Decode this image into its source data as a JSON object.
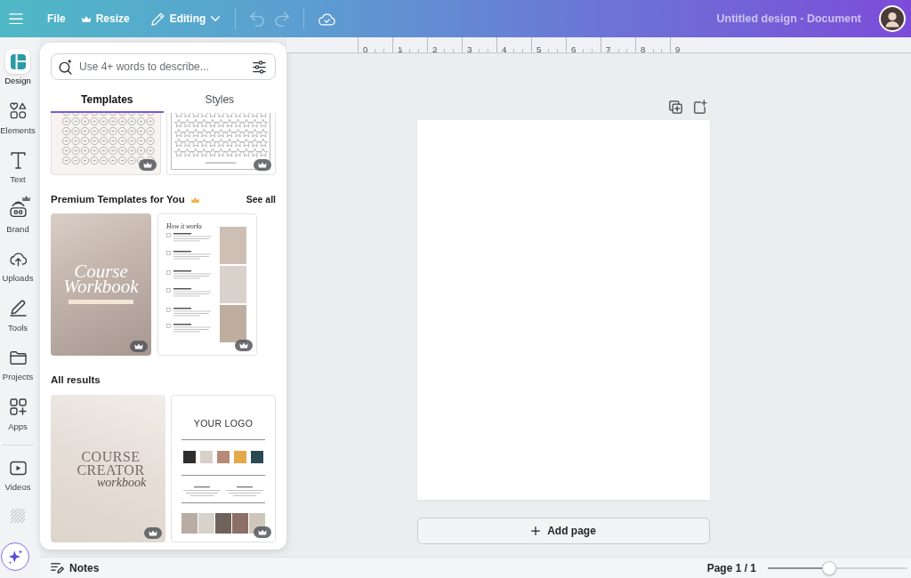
{
  "top_bar": {
    "buttons": [
      {
        "label": "File",
        "kind": "plain"
      },
      {
        "label": "Resize",
        "kind": "premium"
      },
      {
        "label": "Editing",
        "kind": "dropdown"
      }
    ],
    "history": [
      {
        "kind": "undo",
        "disabled": true
      },
      {
        "kind": "redo",
        "disabled": true
      }
    ],
    "title": "Untitled design - Document"
  },
  "sidebar": {
    "items": [
      {
        "label": "Design",
        "selected": true,
        "premium": false
      },
      {
        "label": "Elements",
        "selected": false,
        "premium": false
      },
      {
        "label": "Text",
        "selected": false,
        "premium": false
      },
      {
        "label": "Brand",
        "selected": false,
        "premium": true
      },
      {
        "label": "Uploads",
        "selected": false,
        "premium": false
      },
      {
        "label": "Tools",
        "selected": false,
        "premium": false
      },
      {
        "label": "Projects",
        "selected": false,
        "premium": false
      },
      {
        "label": "Apps",
        "selected": false,
        "premium": false
      }
    ],
    "lower_items": [
      {
        "label": "Videos",
        "selected": false,
        "premium": false
      }
    ]
  },
  "panel": {
    "search": {
      "placeholder": "Use 4+ words to describe..."
    },
    "tabs": [
      {
        "label": "Templates",
        "selected": true
      },
      {
        "label": "Styles",
        "selected": false
      }
    ],
    "sections": [
      {
        "thumbnails": [
          {
            "kind": "circle-grid",
            "premium": true
          },
          {
            "kind": "star-grid",
            "premium": true
          }
        ]
      },
      {
        "title": "Premium Templates for You",
        "premium": true,
        "link": "See all",
        "thumbnails": [
          {
            "kind": "photo-cover",
            "title": "Course Workbook",
            "premium": true
          },
          {
            "kind": "steps-page",
            "title": "How it works",
            "premium": true
          }
        ]
      },
      {
        "title": "All results",
        "premium": false,
        "thumbnails": [
          {
            "kind": "text-cover",
            "title": "COURSE CREATOR",
            "subtitle": "workbook",
            "premium": true
          },
          {
            "kind": "brand-board",
            "title": "YOUR LOGO",
            "swatches": [
              {
                "color": "#2e2e2e"
              },
              {
                "color": "#d8cfc8"
              },
              {
                "color": "#b58b77"
              },
              {
                "color": "#e5a94a"
              },
              {
                "color": "#2c4a56"
              }
            ],
            "premium": true
          }
        ]
      }
    ]
  },
  "ruler": {
    "labels": [
      "0",
      "1",
      "2",
      "3",
      "4",
      "5",
      "6",
      "7",
      "8",
      "9"
    ]
  },
  "canvas": {
    "add_page_label": "Add page"
  },
  "bottom_bar": {
    "notes_label": "Notes",
    "page_indicator": "Page 1 / 1",
    "zoom": {
      "level": 0.43
    }
  }
}
